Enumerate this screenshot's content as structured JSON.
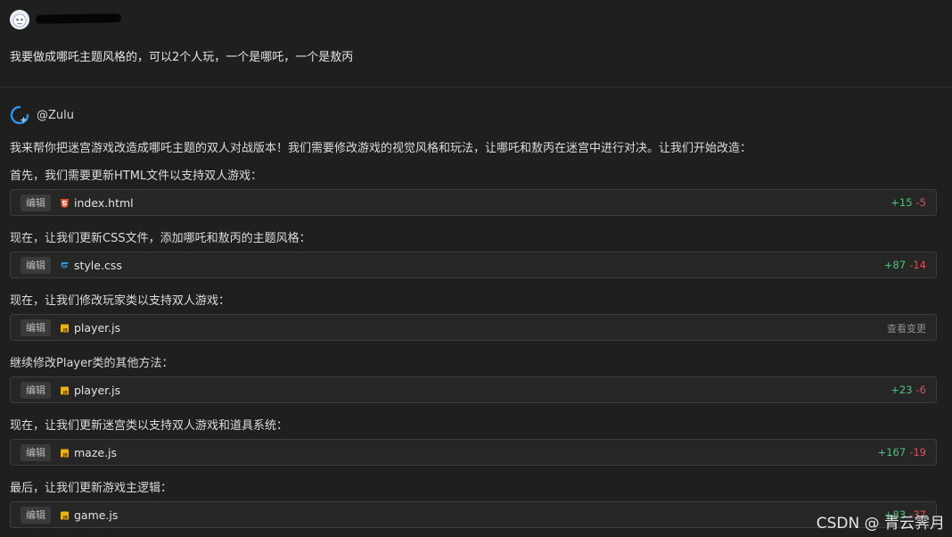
{
  "user": {
    "message": "我要做成哪吒主题风格的，可以2个人玩，一个是哪吒，一个是敖丙"
  },
  "assistant": {
    "name": "@Zulu",
    "intro": "我来帮你把迷宫游戏改造成哪吒主题的双人对战版本！我们需要修改游戏的视觉风格和玩法，让哪吒和敖丙在迷宫中进行对决。让我们开始改造：",
    "steps": [
      {
        "text": "首先，我们需要更新HTML文件以支持双人游戏：",
        "tag": "编辑",
        "file": "index.html",
        "icon": "html5-icon",
        "added": "+15",
        "removed": "-5"
      },
      {
        "text": "现在，让我们更新CSS文件，添加哪吒和敖丙的主题风格：",
        "tag": "编辑",
        "file": "style.css",
        "icon": "css3-icon",
        "added": "+87",
        "removed": "-14"
      },
      {
        "text": "现在，让我们修改玩家类以支持双人游戏：",
        "tag": "编辑",
        "file": "player.js",
        "icon": "js-icon",
        "view_changes": "查看变更"
      },
      {
        "text": "继续修改Player类的其他方法：",
        "tag": "编辑",
        "file": "player.js",
        "icon": "js-icon",
        "added": "+23",
        "removed": "-6"
      },
      {
        "text": "现在，让我们更新迷宫类以支持双人游戏和道具系统：",
        "tag": "编辑",
        "file": "maze.js",
        "icon": "js-icon",
        "added": "+167",
        "removed": "-19"
      },
      {
        "text": "最后，让我们更新游戏主逻辑：",
        "tag": "编辑",
        "file": "game.js",
        "icon": "js-icon",
        "added": "+83",
        "removed": "-37"
      }
    ]
  },
  "watermark": "CSDN @ 青云霁月",
  "colors": {
    "background": "#1f1f1f",
    "card": "#262626",
    "added": "#4cc47a",
    "removed": "#e0505a",
    "html_icon": "#e44d26",
    "css_icon": "#2d9cdb",
    "js_icon": "#e8b21a"
  }
}
